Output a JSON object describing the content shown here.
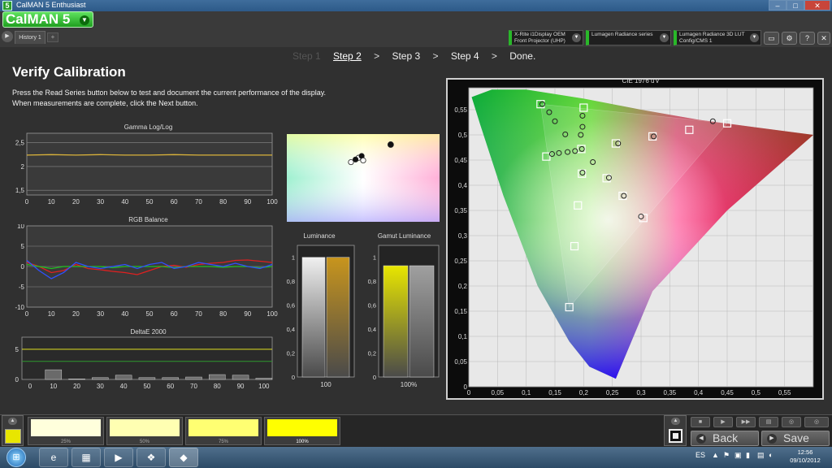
{
  "window": {
    "title": "CalMAN 5 Enthusiast",
    "app_icon": "5",
    "min": "–",
    "max": "□",
    "close": "✕"
  },
  "header": {
    "logo": "CalMAN 5",
    "logo_dropdown": "▼",
    "nav_arrow": "▶",
    "tab_history": "History 1",
    "tab_add": "+",
    "devices": [
      {
        "line1": "X-Rite i1Display OEM",
        "line2": "Front Projector (UHP)"
      },
      {
        "line1": "Lumagen Radiance series",
        "line2": ""
      },
      {
        "line1": "Lumagen Radiance 3D LUT",
        "line2": "Config/CMS 1"
      }
    ],
    "dropdown_glyph": "▼",
    "buttons": {
      "monitor": "▭",
      "settings": "⚙",
      "help": "?",
      "close": "✕"
    }
  },
  "steps": {
    "step1": "Step 1",
    "step2": "Step 2",
    "step3": "Step 3",
    "step4": "Step 4",
    "done": "Done.",
    "sep": ">"
  },
  "page": {
    "title": "Verify Calibration",
    "instructions_1": "Press the Read Series button below to test and document the current performance of the display.",
    "instructions_2": "When measurements are complete, click the Next button."
  },
  "chart_data": [
    {
      "type": "line",
      "title": "Gamma Log/Log",
      "x_ticks": [
        "0",
        "10",
        "20",
        "30",
        "40",
        "50",
        "60",
        "70",
        "80",
        "90",
        "100"
      ],
      "y_ticks": [
        "2,5",
        "2",
        "1,5"
      ],
      "ylim": [
        1.4,
        2.7
      ],
      "x": [
        0,
        10,
        20,
        30,
        40,
        50,
        60,
        70,
        80,
        90,
        100
      ],
      "series": [
        {
          "values": [
            2.24,
            2.25,
            2.24,
            2.25,
            2.24,
            2.24,
            2.25,
            2.24,
            2.24,
            2.24,
            2.24
          ],
          "color": "#d9b23a"
        }
      ]
    },
    {
      "type": "line",
      "title": "RGB Balance",
      "x_ticks": [
        "0",
        "10",
        "20",
        "30",
        "40",
        "50",
        "60",
        "70",
        "80",
        "90",
        "100"
      ],
      "y_ticks": [
        "10",
        "5",
        "0",
        "-5",
        "-10"
      ],
      "ylim": [
        -10,
        10
      ],
      "x": [
        0,
        5,
        10,
        15,
        20,
        25,
        30,
        35,
        40,
        45,
        50,
        55,
        60,
        65,
        70,
        75,
        80,
        85,
        90,
        95,
        100
      ],
      "series": [
        {
          "values": [
            1,
            0,
            -1.5,
            -1,
            0.5,
            -0.5,
            -0.8,
            -1.2,
            -1.5,
            -2,
            -1,
            0,
            0.3,
            -0.2,
            0.5,
            0.8,
            1,
            1.5,
            1.6,
            1.3,
            1
          ],
          "color": "#e02020"
        },
        {
          "values": [
            0.5,
            0,
            -0.5,
            0,
            0,
            0,
            0,
            -0.3,
            0,
            0,
            0,
            0,
            -0.3,
            0,
            0,
            0,
            -0.2,
            0,
            0,
            -0.3,
            0
          ],
          "color": "#20c020"
        },
        {
          "values": [
            1.5,
            -1,
            -3,
            -1.5,
            1,
            0,
            -0.5,
            0,
            0.5,
            -0.5,
            0.5,
            1,
            -0.5,
            0,
            1,
            0.5,
            0,
            0.8,
            0,
            -0.5,
            0.5
          ],
          "color": "#3050ff"
        }
      ]
    },
    {
      "type": "bar",
      "title": "DeltaE 2000",
      "categories": [
        "0",
        "10",
        "20",
        "30",
        "40",
        "50",
        "60",
        "70",
        "80",
        "90",
        "100"
      ],
      "values": [
        0,
        1.6,
        0.1,
        0.3,
        0.7,
        0.3,
        0.3,
        0.4,
        0.8,
        0.7,
        0.2
      ],
      "y_ticks": [
        "5",
        "0"
      ],
      "ylim": [
        0,
        7
      ],
      "thresholds": [
        {
          "value": 5,
          "color": "#e0e020"
        },
        {
          "value": 3,
          "color": "#2e9a2e"
        }
      ]
    },
    {
      "type": "bar",
      "title": "Luminance",
      "categories": [
        "100"
      ],
      "values": [
        1.0,
        1.0
      ],
      "bar_colors": [
        "#f0f0f0",
        "#c8951d"
      ],
      "y_ticks": [
        "1",
        "0,8",
        "0,6",
        "0,4",
        "0,2",
        "0"
      ],
      "ylim": [
        0,
        1.1
      ]
    },
    {
      "type": "bar",
      "title": "Gamut Luminance",
      "categories": [
        "100%"
      ],
      "values": [
        0.93,
        0.93
      ],
      "bar_colors": [
        "#e8e600",
        "#a0a0a0"
      ],
      "y_ticks": [
        "1",
        "0,8",
        "0,6",
        "0,4",
        "0,2",
        "0"
      ],
      "ylim": [
        0,
        1.1
      ]
    },
    {
      "type": "scatter",
      "title": "CIE 1976 u'v'",
      "x_ticks": [
        "0",
        "0,05",
        "0,1",
        "0,15",
        "0,2",
        "0,25",
        "0,3",
        "0,35",
        "0,4",
        "0,45",
        "0,5",
        "0,55"
      ],
      "y_ticks": [
        "0,55",
        "0,5",
        "0,45",
        "0,4",
        "0,35",
        "0,3",
        "0,25",
        "0,2",
        "0,15",
        "0,1",
        "0,05",
        "0"
      ],
      "xlim": [
        0,
        0.6
      ],
      "ylim": [
        0,
        0.6
      ],
      "targets": [
        [
          0.125,
          0.561
        ],
        [
          0.2,
          0.554
        ],
        [
          0.135,
          0.457
        ],
        [
          0.196,
          0.472
        ],
        [
          0.197,
          0.423
        ],
        [
          0.19,
          0.36
        ],
        [
          0.184,
          0.279
        ],
        [
          0.175,
          0.158
        ],
        [
          0.45,
          0.523
        ],
        [
          0.384,
          0.51
        ],
        [
          0.32,
          0.497
        ],
        [
          0.256,
          0.483
        ],
        [
          0.24,
          0.414
        ],
        [
          0.268,
          0.379
        ],
        [
          0.304,
          0.335
        ]
      ],
      "measured": [
        [
          0.128,
          0.561
        ],
        [
          0.14,
          0.545
        ],
        [
          0.15,
          0.527
        ],
        [
          0.168,
          0.501
        ],
        [
          0.195,
          0.5
        ],
        [
          0.198,
          0.538
        ],
        [
          0.198,
          0.516
        ],
        [
          0.145,
          0.462
        ],
        [
          0.157,
          0.464
        ],
        [
          0.172,
          0.466
        ],
        [
          0.185,
          0.468
        ],
        [
          0.197,
          0.472
        ],
        [
          0.216,
          0.446
        ],
        [
          0.198,
          0.425
        ],
        [
          0.425,
          0.527
        ],
        [
          0.322,
          0.497
        ],
        [
          0.26,
          0.483
        ],
        [
          0.244,
          0.415
        ],
        [
          0.27,
          0.379
        ],
        [
          0.3,
          0.338
        ]
      ]
    }
  ],
  "color_swatch": {
    "points": [
      {
        "x": 0.68,
        "y": 0.12
      },
      {
        "x": 0.47,
        "y": 0.27
      },
      {
        "x": 0.49,
        "y": 0.25
      },
      {
        "x": 0.5,
        "y": 0.3
      },
      {
        "x": 0.45,
        "y": 0.29
      },
      {
        "x": 0.42,
        "y": 0.32
      }
    ]
  },
  "patches": [
    {
      "label": "25%",
      "color": "#ffffdc"
    },
    {
      "label": "50%",
      "color": "#ffffb2"
    },
    {
      "label": "75%",
      "color": "#ffff72"
    },
    {
      "label": "100%",
      "color": "#ffff00"
    }
  ],
  "controls": {
    "toggle": "▲",
    "back": "Back",
    "save": "Save",
    "back_icon": "◀",
    "save_icon": "▶",
    "play_buttons": [
      "■",
      "▶",
      "▶▶",
      "▤",
      "◎",
      "◎",
      "◎"
    ]
  },
  "taskbar": {
    "start": "⊞",
    "apps": [
      "e",
      "▦",
      "▶",
      "❖",
      "◆"
    ],
    "language": "ES",
    "tray_icons": [
      "▲",
      "⚑",
      "▣",
      "▮",
      "▤",
      "◐"
    ],
    "time": "12:56",
    "date": "09/10/2012"
  }
}
